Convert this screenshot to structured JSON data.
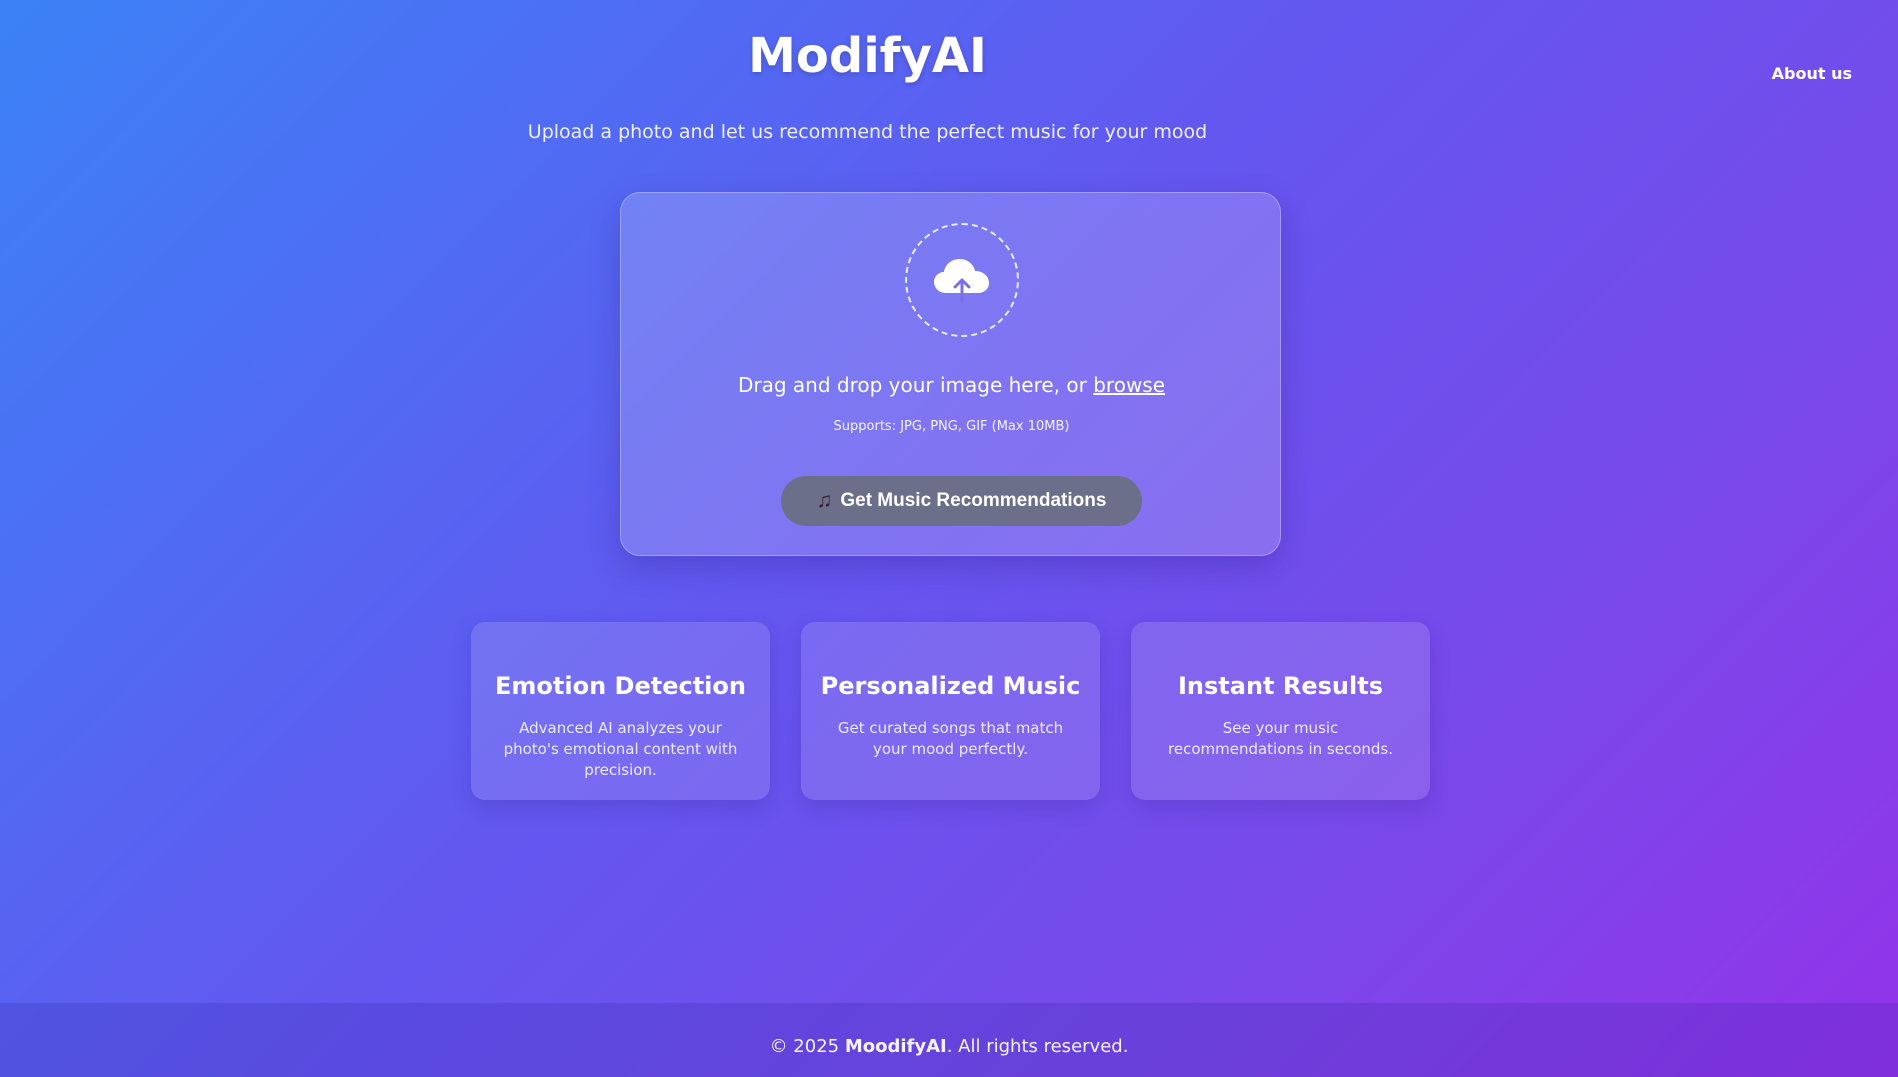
{
  "header": {
    "title": "ModifyAI",
    "about_label": "About us"
  },
  "hero": {
    "subtitle": "Upload a photo and let us recommend the perfect music for your mood"
  },
  "upload": {
    "icon": "cloud-upload-icon",
    "drop_text": "Drag and drop your image here, or",
    "browse_label": "browse",
    "supports_text": "Supports: JPG, PNG, GIF (Max 10MB)",
    "button_icon": "music-note-icon",
    "button_label": "Get Music Recommendations"
  },
  "features": [
    {
      "title": "Emotion Detection",
      "description": "Advanced AI analyzes your photo's emotional content with precision."
    },
    {
      "title": "Personalized Music",
      "description": "Get curated songs that match your mood perfectly."
    },
    {
      "title": "Instant Results",
      "description": "See your music recommendations in seconds."
    }
  ],
  "footer": {
    "prefix": "© 2025",
    "brand": "MoodifyAI",
    "suffix": ". All rights reserved."
  },
  "colors": {
    "gradient_start": "#3b82f6",
    "gradient_end": "#9333ea",
    "button_bg": "#6b6f8a"
  }
}
